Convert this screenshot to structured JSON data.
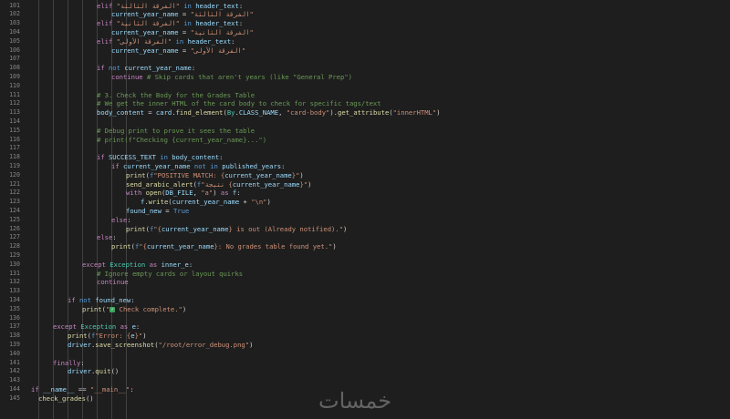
{
  "editor": {
    "lines": [
      {
        "n": "101",
        "indent": 9,
        "toks": [
          [
            "kw",
            "elif "
          ],
          [
            "str",
            "\"الفرقة الثالثة\""
          ],
          [
            "kwb",
            " in "
          ],
          [
            "var",
            "header_text"
          ],
          [
            "p",
            ":"
          ]
        ]
      },
      {
        "n": "102",
        "indent": 11,
        "toks": [
          [
            "var",
            "current_year_name"
          ],
          [
            "p",
            " = "
          ],
          [
            "str",
            "\"الفرقة الثالثة\""
          ]
        ]
      },
      {
        "n": "103",
        "indent": 9,
        "toks": [
          [
            "kw",
            "elif "
          ],
          [
            "str",
            "\"الفرقة الثانية\""
          ],
          [
            "kwb",
            " in "
          ],
          [
            "var",
            "header_text"
          ],
          [
            "p",
            ":"
          ]
        ]
      },
      {
        "n": "104",
        "indent": 11,
        "toks": [
          [
            "var",
            "current_year_name"
          ],
          [
            "p",
            " = "
          ],
          [
            "str",
            "\"الفرقة الثانية\""
          ]
        ]
      },
      {
        "n": "105",
        "indent": 9,
        "toks": [
          [
            "kw",
            "elif "
          ],
          [
            "str",
            "\"الفرقة الأولى\""
          ],
          [
            "kwb",
            " in "
          ],
          [
            "var",
            "header_text"
          ],
          [
            "p",
            ":"
          ]
        ]
      },
      {
        "n": "106",
        "indent": 11,
        "toks": [
          [
            "var",
            "current_year_name"
          ],
          [
            "p",
            " = "
          ],
          [
            "str",
            "\"الفرقة الأولى\""
          ]
        ]
      },
      {
        "n": "107",
        "indent": 0,
        "toks": []
      },
      {
        "n": "108",
        "indent": 9,
        "toks": [
          [
            "kw",
            "if "
          ],
          [
            "kwb",
            "not "
          ],
          [
            "var",
            "current_year_name"
          ],
          [
            "p",
            ":"
          ]
        ]
      },
      {
        "n": "109",
        "indent": 11,
        "toks": [
          [
            "kw",
            "continue "
          ],
          [
            "cmt",
            "# Skip cards that aren't years (like \"General Prep\")"
          ]
        ]
      },
      {
        "n": "110",
        "indent": 0,
        "toks": []
      },
      {
        "n": "111",
        "indent": 9,
        "toks": [
          [
            "cmt",
            "# 3. Check the Body for the Grades Table"
          ]
        ]
      },
      {
        "n": "112",
        "indent": 9,
        "toks": [
          [
            "cmt",
            "# We get the inner HTML of the card body to check for specific tags/text"
          ]
        ]
      },
      {
        "n": "113",
        "indent": 9,
        "toks": [
          [
            "var",
            "body_content"
          ],
          [
            "p",
            " = "
          ],
          [
            "var",
            "card"
          ],
          [
            "p",
            "."
          ],
          [
            "fn",
            "find_element"
          ],
          [
            "p",
            "("
          ],
          [
            "cls",
            "By"
          ],
          [
            "p",
            "."
          ],
          [
            "var",
            "CLASS_NAME"
          ],
          [
            "p",
            ", "
          ],
          [
            "str",
            "\"card-body\""
          ],
          [
            "p",
            ")."
          ],
          [
            "fn",
            "get_attribute"
          ],
          [
            "p",
            "("
          ],
          [
            "str",
            "\"innerHTML\""
          ],
          [
            "p",
            ")"
          ]
        ]
      },
      {
        "n": "114",
        "indent": 0,
        "toks": []
      },
      {
        "n": "115",
        "indent": 9,
        "toks": [
          [
            "cmt",
            "# Debug print to prove it sees the table"
          ]
        ]
      },
      {
        "n": "116",
        "indent": 9,
        "toks": [
          [
            "cmt",
            "# print(f\"Checking {current_year_name}...\")"
          ]
        ]
      },
      {
        "n": "117",
        "indent": 0,
        "toks": []
      },
      {
        "n": "118",
        "indent": 9,
        "toks": [
          [
            "kw",
            "if "
          ],
          [
            "var",
            "SUCCESS_TEXT"
          ],
          [
            "kwb",
            " in "
          ],
          [
            "var",
            "body_content"
          ],
          [
            "p",
            ":"
          ]
        ]
      },
      {
        "n": "119",
        "indent": 11,
        "toks": [
          [
            "kw",
            "if "
          ],
          [
            "var",
            "current_year_name"
          ],
          [
            "kwb",
            " not in "
          ],
          [
            "var",
            "published_years"
          ],
          [
            "p",
            ":"
          ]
        ]
      },
      {
        "n": "120",
        "indent": 13,
        "toks": [
          [
            "fn",
            "print"
          ],
          [
            "p",
            "("
          ],
          [
            "kwb",
            "f"
          ],
          [
            "str",
            "\"POSITIVE MATCH: {"
          ],
          [
            "var",
            "current_year_name"
          ],
          [
            "str",
            "}\""
          ],
          [
            "p",
            ")"
          ]
        ]
      },
      {
        "n": "121",
        "indent": 13,
        "toks": [
          [
            "fn",
            "send_arabic_alert"
          ],
          [
            "p",
            "("
          ],
          [
            "kwb",
            "f"
          ],
          [
            "str",
            "\"نتيجة {"
          ],
          [
            "var",
            "current_year_name"
          ],
          [
            "str",
            "}\""
          ],
          [
            "p",
            ")"
          ]
        ]
      },
      {
        "n": "122",
        "indent": 13,
        "toks": [
          [
            "kw",
            "with "
          ],
          [
            "fn",
            "open"
          ],
          [
            "p",
            "("
          ],
          [
            "var",
            "DB_FILE"
          ],
          [
            "p",
            ", "
          ],
          [
            "str",
            "\"a\""
          ],
          [
            "p",
            ") "
          ],
          [
            "kw",
            "as "
          ],
          [
            "var",
            "f"
          ],
          [
            "p",
            ":"
          ]
        ]
      },
      {
        "n": "123",
        "indent": 15,
        "toks": [
          [
            "var",
            "f"
          ],
          [
            "p",
            "."
          ],
          [
            "fn",
            "write"
          ],
          [
            "p",
            "("
          ],
          [
            "var",
            "current_year_name"
          ],
          [
            "p",
            " + "
          ],
          [
            "str",
            "\"\\n\""
          ],
          [
            "p",
            ")"
          ]
        ]
      },
      {
        "n": "124",
        "indent": 13,
        "toks": [
          [
            "var",
            "found_new"
          ],
          [
            "p",
            " = "
          ],
          [
            "kwb",
            "True"
          ]
        ]
      },
      {
        "n": "125",
        "indent": 11,
        "toks": [
          [
            "kw",
            "else"
          ],
          [
            "p",
            ":"
          ]
        ]
      },
      {
        "n": "126",
        "indent": 13,
        "toks": [
          [
            "fn",
            "print"
          ],
          [
            "p",
            "("
          ],
          [
            "kwb",
            "f"
          ],
          [
            "str",
            "\"{"
          ],
          [
            "var",
            "current_year_name"
          ],
          [
            "str",
            "} is out (Already notified).\""
          ],
          [
            "p",
            ")"
          ]
        ]
      },
      {
        "n": "127",
        "indent": 9,
        "toks": [
          [
            "kw",
            "else"
          ],
          [
            "p",
            ":"
          ]
        ]
      },
      {
        "n": "128",
        "indent": 11,
        "toks": [
          [
            "fn",
            "print"
          ],
          [
            "p",
            "("
          ],
          [
            "kwb",
            "f"
          ],
          [
            "str",
            "\"{"
          ],
          [
            "var",
            "current_year_name"
          ],
          [
            "str",
            "}: No grades table found yet.\""
          ],
          [
            "p",
            ")"
          ]
        ]
      },
      {
        "n": "129",
        "indent": 0,
        "toks": []
      },
      {
        "n": "130",
        "indent": 7,
        "toks": [
          [
            "kw",
            "except "
          ],
          [
            "cls",
            "Exception"
          ],
          [
            "kw",
            " as "
          ],
          [
            "var",
            "inner_e"
          ],
          [
            "p",
            ":"
          ]
        ]
      },
      {
        "n": "131",
        "indent": 9,
        "toks": [
          [
            "cmt",
            "# Ignore empty cards or layout quirks"
          ]
        ]
      },
      {
        "n": "132",
        "indent": 9,
        "toks": [
          [
            "kw",
            "continue"
          ]
        ]
      },
      {
        "n": "133",
        "indent": 0,
        "toks": []
      },
      {
        "n": "134",
        "indent": 5,
        "toks": [
          [
            "kw",
            "if "
          ],
          [
            "kwb",
            "not "
          ],
          [
            "var",
            "found_new"
          ],
          [
            "p",
            ":"
          ]
        ]
      },
      {
        "n": "135",
        "indent": 7,
        "toks": [
          [
            "fn",
            "print"
          ],
          [
            "p",
            "("
          ],
          [
            "str",
            "\""
          ],
          [
            "emoji",
            "✓"
          ],
          [
            "str",
            " Check complete.\""
          ],
          [
            "p",
            ")"
          ]
        ]
      },
      {
        "n": "136",
        "indent": 0,
        "toks": []
      },
      {
        "n": "137",
        "indent": 3,
        "toks": [
          [
            "kw",
            "except "
          ],
          [
            "cls",
            "Exception"
          ],
          [
            "kw",
            " as "
          ],
          [
            "var",
            "e"
          ],
          [
            "p",
            ":"
          ]
        ]
      },
      {
        "n": "138",
        "indent": 5,
        "toks": [
          [
            "fn",
            "print"
          ],
          [
            "p",
            "("
          ],
          [
            "kwb",
            "f"
          ],
          [
            "str",
            "\"Error: {"
          ],
          [
            "var",
            "e"
          ],
          [
            "str",
            "}\""
          ],
          [
            "p",
            ")"
          ]
        ]
      },
      {
        "n": "139",
        "indent": 5,
        "toks": [
          [
            "var",
            "driver"
          ],
          [
            "p",
            "."
          ],
          [
            "fn",
            "save_screenshot"
          ],
          [
            "p",
            "("
          ],
          [
            "str",
            "\"/root/error_debug.png\""
          ],
          [
            "p",
            ")"
          ]
        ]
      },
      {
        "n": "140",
        "indent": 0,
        "toks": []
      },
      {
        "n": "141",
        "indent": 3,
        "toks": [
          [
            "kw",
            "finally"
          ],
          [
            "p",
            ":"
          ]
        ]
      },
      {
        "n": "142",
        "indent": 5,
        "toks": [
          [
            "var",
            "driver"
          ],
          [
            "p",
            "."
          ],
          [
            "fn",
            "quit"
          ],
          [
            "p",
            "()"
          ]
        ]
      },
      {
        "n": "143",
        "indent": 0,
        "toks": []
      },
      {
        "n": "144",
        "indent": 0,
        "toks": [
          [
            "kw",
            "if "
          ],
          [
            "var",
            "__name__"
          ],
          [
            "p",
            " == "
          ],
          [
            "str",
            "\"__main__\""
          ],
          [
            "p",
            ":"
          ]
        ]
      },
      {
        "n": "145",
        "indent": 1,
        "toks": [
          [
            "fn",
            "check_grades"
          ],
          [
            "p",
            "()"
          ]
        ]
      }
    ]
  },
  "watermark": {
    "text": "خمسات"
  },
  "colors": {
    "background": "#1e1e1e",
    "keyword": "#c586c0",
    "builtin": "#569cd6",
    "function": "#dcdcaa",
    "variable": "#9cdcfe",
    "string": "#ce9178",
    "comment": "#6a9955",
    "class": "#4ec9b0"
  }
}
